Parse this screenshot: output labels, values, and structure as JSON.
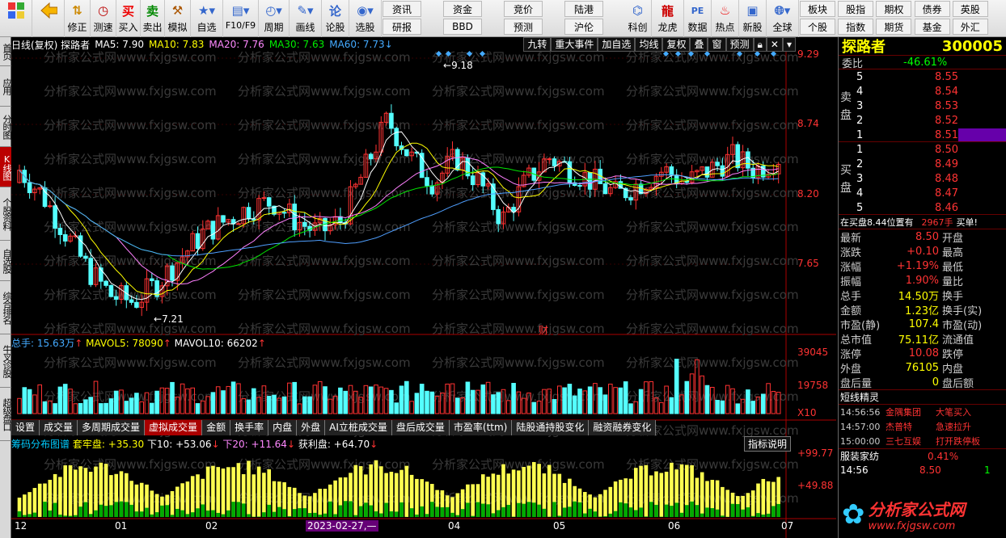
{
  "toolbar": {
    "buttons": [
      {
        "name": "home-button",
        "label": "",
        "icon": "windows-grid-icon"
      },
      {
        "name": "back-button",
        "label": "",
        "icon": "back-arrow-icon"
      },
      {
        "name": "adjust-button",
        "label": "修正",
        "icon": "up-down-icon"
      },
      {
        "name": "test-button",
        "label": "测速",
        "icon": "clock-icon"
      },
      {
        "name": "buy-button",
        "label": "买入",
        "icon": "buy-icon",
        "glyph": "买"
      },
      {
        "name": "sell-button",
        "label": "卖出",
        "icon": "sell-icon",
        "glyph": "卖"
      },
      {
        "name": "simulate-button",
        "label": "模拟",
        "icon": "hammer-icon"
      },
      {
        "name": "self-select-button",
        "label": "自选",
        "icon": "star-folder-icon"
      },
      {
        "name": "f10-button",
        "label": "F10/F9",
        "icon": "document-icon"
      },
      {
        "name": "period-button",
        "label": "周期",
        "icon": "clock-dial-icon"
      },
      {
        "name": "draw-button",
        "label": "画线",
        "icon": "pencil-icon"
      },
      {
        "name": "stock-talk-button",
        "label": "论股",
        "icon": "talk-icon"
      },
      {
        "name": "pick-button",
        "label": "选股",
        "icon": "radar-icon"
      }
    ],
    "grid": [
      "资讯",
      "研报",
      "资金",
      "BBD",
      "竞价",
      "预测",
      "陆港",
      "沪伦",
      "科创",
      "龙虎",
      "数据",
      "热点",
      "新股"
    ],
    "grid_icons": [
      {
        "name": "sci-button",
        "label": "科创",
        "icon": "sci-icon"
      },
      {
        "name": "dragon-button",
        "label": "龙虎",
        "icon": "dragon-icon"
      },
      {
        "name": "data-button",
        "label": "数据",
        "icon": "pe-icon"
      },
      {
        "name": "hot-button",
        "label": "热点",
        "icon": "hot-icon"
      },
      {
        "name": "ipo-button",
        "label": "新股",
        "icon": "ipo-icon"
      }
    ],
    "global_label": "全球",
    "right_grid": [
      "板块",
      "个股",
      "股指",
      "指数",
      "期权",
      "期货",
      "债券",
      "基金",
      "英股",
      "外汇"
    ]
  },
  "left_tabs": [
    {
      "label": "首页",
      "active": false
    },
    {
      "label": "应用",
      "active": false
    },
    {
      "label": "分时图",
      "active": false
    },
    {
      "label": "K线图",
      "active": true
    },
    {
      "label": "个股资料",
      "active": false
    },
    {
      "label": "自选股",
      "active": false
    },
    {
      "label": "综合排名",
      "active": false
    },
    {
      "label": "牛叉诊股",
      "active": false
    },
    {
      "label": "超级盘口",
      "active": false
    }
  ],
  "infobar": {
    "title": "日线(复权) 探路者",
    "ma5": "MA5: 7.90",
    "ma10": "MA10: 7.83",
    "ma20": "MA20: 7.76",
    "ma30": "MA30: 7.63",
    "ma60": "MA60: 7.73",
    "ma60_arrow": "↓"
  },
  "top_buttons": [
    "九转",
    "重大事件",
    "加自选",
    "均线",
    "复权",
    "叠",
    "窗",
    "预测"
  ],
  "price_axis": [
    "9.29",
    "8.74",
    "8.20",
    "7.65"
  ],
  "price_labels": {
    "high": "9.18",
    "low": "7.21"
  },
  "fin_badge": "财",
  "volume": {
    "label": "总手: 15.63万",
    "mavol5": "MAVOL5: 78090",
    "mavol10": "MAVOL10: 66202",
    "axis": [
      "39045",
      "19758",
      "X10"
    ]
  },
  "bottom_tabs": [
    "设置",
    "成交量",
    "多周期成交量",
    "虚拟成交量",
    "金额",
    "换手率",
    "内盘",
    "外盘",
    "AI立桩成交量",
    "盘后成交量",
    "市盈率(ttm)",
    "陆股通持股变化",
    "融资融券变化"
  ],
  "active_bottom_tab": "虚拟成交量",
  "chip": {
    "title": "筹码分布图谱",
    "trap": "套牢盘: +35.30",
    "down10": "下10: +53.06",
    "down20": "下20: +11.64",
    "profit": "获利盘: +64.70",
    "help": "指标说明",
    "axis": [
      "+99.77",
      "+49.88"
    ]
  },
  "x_axis": [
    "12",
    "01",
    "02",
    "2023-02-27,—",
    "04",
    "05",
    "06",
    "07"
  ],
  "quote": {
    "name": "探路者",
    "code": "300005",
    "weibi_label": "委比",
    "weibi": "-46.61%",
    "sell_label": "卖盘",
    "sell_rows": [
      [
        "5",
        "8.55"
      ],
      [
        "4",
        "8.54"
      ],
      [
        "3",
        "8.53"
      ],
      [
        "2",
        "8.52"
      ],
      [
        "1",
        "8.51"
      ]
    ],
    "buy_label": "买盘",
    "buy_rows": [
      [
        "1",
        "8.50"
      ],
      [
        "2",
        "8.49"
      ],
      [
        "3",
        "8.48"
      ],
      [
        "4",
        "8.47"
      ],
      [
        "5",
        "8.46"
      ]
    ],
    "notice": "在买盘8.44位置有",
    "notice_qty": "2967手",
    "notice_tail": "买单!",
    "stats": [
      [
        "最新",
        "8.50",
        "开盘",
        ""
      ],
      [
        "涨跌",
        "+0.10",
        "最高",
        ""
      ],
      [
        "涨幅",
        "+1.19%",
        "最低",
        ""
      ],
      [
        "振幅",
        "1.90%",
        "量比",
        ""
      ],
      [
        "总手",
        "14.50万",
        "换手",
        ""
      ],
      [
        "金额",
        "1.23亿",
        "换手(实)",
        ""
      ],
      [
        "市盈(静)",
        "107.4",
        "市盈(动)",
        ""
      ],
      [
        "总市值",
        "75.11亿",
        "流通值",
        ""
      ],
      [
        "涨停",
        "10.08",
        "跌停",
        ""
      ],
      [
        "外盘",
        "76105",
        "内盘",
        ""
      ],
      [
        "盘后量",
        "0",
        "盘后额",
        ""
      ]
    ],
    "news_title": "短线精灵",
    "news": [
      [
        "14:56:56",
        "金隅集团",
        "大笔买入"
      ],
      [
        "14:57:00",
        "杰普特",
        "急速拉升"
      ],
      [
        "15:00:00",
        "三七互娱",
        "打开跌停板"
      ]
    ],
    "sector": "服装家纺",
    "sector_pct": "0.41%",
    "tick_time": "14:56",
    "tick_price": "8.50",
    "tick_qty": "1"
  },
  "watermark": "分析家公式网www.fxjgsw.com",
  "logo_text": "分析家公式网",
  "logo_url": "www.fxjgsw.com",
  "colors": {
    "up": "#ff3232",
    "down": "#54ffff",
    "ma5": "#ffffff",
    "ma10": "#ffff00",
    "ma20": "#ff80ff",
    "ma30": "#00e600",
    "ma60": "#4f9fff"
  }
}
